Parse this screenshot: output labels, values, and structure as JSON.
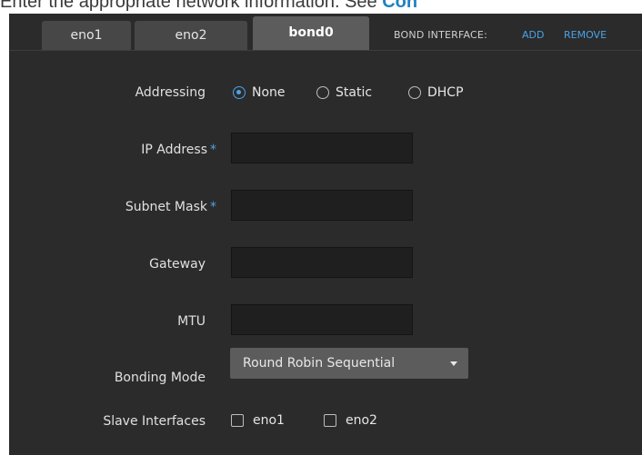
{
  "intro": {
    "text": "Enter the appropriate network information. See ",
    "link": "Con"
  },
  "tabs": [
    {
      "label": "eno1",
      "active": false
    },
    {
      "label": "eno2",
      "active": false
    },
    {
      "label": "bond0",
      "active": true
    }
  ],
  "bond_interface": {
    "label": "BOND INTERFACE:",
    "add": "ADD",
    "remove": "REMOVE"
  },
  "form": {
    "addressing": {
      "label": "Addressing",
      "options": [
        "None",
        "Static",
        "DHCP"
      ],
      "selected": "None"
    },
    "ip_address": {
      "label": "IP Address",
      "required": "*",
      "value": ""
    },
    "subnet_mask": {
      "label": "Subnet Mask",
      "required": "*",
      "value": ""
    },
    "gateway": {
      "label": "Gateway",
      "value": ""
    },
    "mtu": {
      "label": "MTU",
      "value": ""
    },
    "bonding_mode": {
      "label": "Bonding Mode",
      "value": "Round Robin Sequential"
    },
    "slave_interfaces": {
      "label": "Slave Interfaces",
      "options": [
        {
          "label": "eno1",
          "checked": false
        },
        {
          "label": "eno2",
          "checked": false
        }
      ]
    }
  },
  "colors": {
    "panel": "#2b2b2b",
    "accent": "#4aa3e8",
    "tab": "#474747",
    "tab_active": "#5c5c5c"
  }
}
